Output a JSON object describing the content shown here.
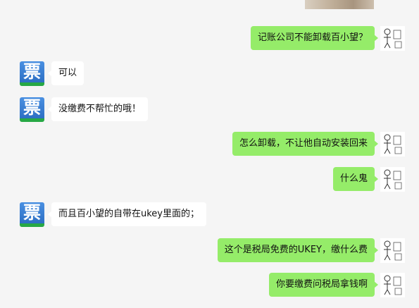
{
  "chat": {
    "theme": {
      "me_bubble": "#95ec69",
      "them_bubble": "#ffffff",
      "background": "#f5f5f5"
    },
    "contact_avatar_glyph": "票",
    "messages": [
      {
        "sender": "me",
        "text": "记账公司不能卸载百小望？"
      },
      {
        "sender": "them",
        "text": "可以"
      },
      {
        "sender": "them",
        "text": "没缴费不帮忙的哦！"
      },
      {
        "sender": "me",
        "text": "怎么卸载，不让他自动安装回来"
      },
      {
        "sender": "me",
        "text": "什么鬼"
      },
      {
        "sender": "them",
        "text": "而且百小望的自带在ukey里面的；"
      },
      {
        "sender": "me",
        "text": "这个是税局免费的UKEY，缴什么费"
      },
      {
        "sender": "me",
        "text": "你要缴费问税局拿钱啊"
      }
    ]
  }
}
